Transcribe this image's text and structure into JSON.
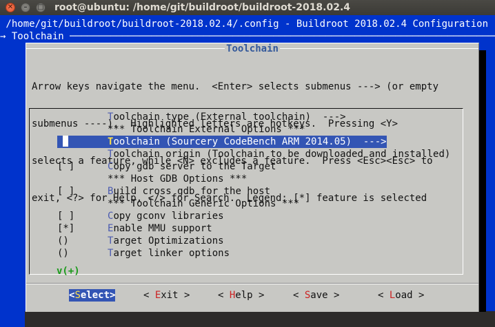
{
  "window": {
    "title": "root@ubuntu: /home/git/buildroot/buildroot-2018.02.4",
    "close_glyph": "✕",
    "min_glyph": "–",
    "max_glyph": "□"
  },
  "terminal": {
    "header_path": " /home/git/buildroot/buildroot-2018.02.4/.config - Buildroot 2018.02.4 Configuration",
    "header_crumb": "→ Toolchain ─────────────────────────────────────────────────────────────────────────────"
  },
  "dialog": {
    "title": "Toolchain",
    "help_lines": [
      "Arrow keys navigate the menu.  <Enter> selects submenus ---> (or empty",
      "submenus ----).  Highlighted letters are hotkeys.  Pressing <Y>",
      "selects a feature, while <N> excludes a feature.  Press <Esc><Esc> to",
      "exit, <?> for Help, </> for Search.  Legend: [*] feature is selected"
    ],
    "items": [
      {
        "prefix": "",
        "hotkey": "T",
        "rest": "oolchain type (External toolchain)  --->"
      },
      {
        "prefix": "",
        "hotkey": "",
        "rest": "*** Toolchain External Options ***"
      },
      {
        "prefix": "",
        "hotkey": "T",
        "rest": "oolchain (Sourcery CodeBench ARM 2014.05)  --->"
      },
      {
        "prefix": "",
        "hotkey": "T",
        "rest": "oolchain origin (Toolchain to be downloaded and installed)"
      },
      {
        "prefix": "[ ]",
        "hotkey": "C",
        "rest": "opy gdb server to the Target"
      },
      {
        "prefix": "",
        "hotkey": "",
        "rest": "*** Host GDB Options ***"
      },
      {
        "prefix": "[ ]",
        "hotkey": "B",
        "rest": "uild cross gdb for the host"
      },
      {
        "prefix": "",
        "hotkey": "",
        "rest": "*** Toolchain Generic Options ***"
      },
      {
        "prefix": "[ ]",
        "hotkey": "C",
        "rest": "opy gconv libraries"
      },
      {
        "prefix": "[*]",
        "hotkey": "E",
        "rest": "nable MMU support"
      },
      {
        "prefix": "()",
        "hotkey": "T",
        "rest": "arget Optimizations"
      },
      {
        "prefix": "()",
        "hotkey": "T",
        "rest": "arget linker options"
      }
    ],
    "selected_index": 2,
    "more_indicator": "v(+)",
    "buttons": [
      {
        "open": "<",
        "hotkey": "S",
        "rest": "elect",
        "close": ">"
      },
      {
        "open": "< ",
        "hotkey": "E",
        "rest": "xit",
        "close": " >"
      },
      {
        "open": "< ",
        "hotkey": "H",
        "rest": "elp",
        "close": " >"
      },
      {
        "open": "< ",
        "hotkey": "S",
        "rest": "ave",
        "close": " >"
      },
      {
        "open": "< ",
        "hotkey": "L",
        "rest": "oad",
        "close": " >"
      }
    ]
  }
}
